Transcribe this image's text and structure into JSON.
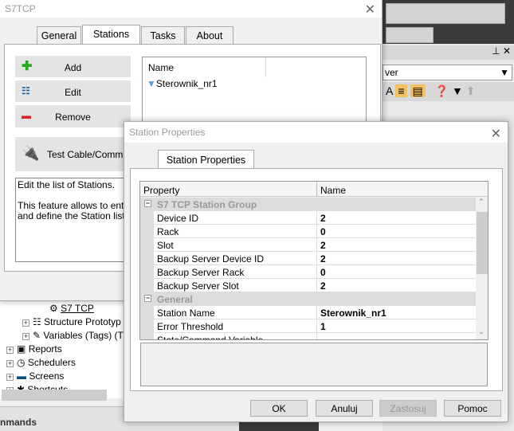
{
  "main_dialog": {
    "title": "S7TCP",
    "tabs": [
      "General",
      "Stations",
      "Tasks",
      "About"
    ],
    "active_tab": "Stations",
    "commands": {
      "add": "Add",
      "edit": "Edit",
      "remove": "Remove",
      "test": "Test Cable/Comm."
    },
    "description": [
      "Edit the list of Stations.",
      "This feature allows to enter and define the Station list"
    ],
    "list": {
      "header": "Name",
      "items": [
        "Sterownik_nr1"
      ]
    }
  },
  "background": {
    "dropdown_value": "ver",
    "tree": {
      "selected": "S7 TCP",
      "items": [
        "Structure Prototyp",
        "Variables (Tags) (T",
        "Reports",
        "Schedulers",
        "Screens",
        "Shortcuts"
      ]
    },
    "bottom_label": "nmands"
  },
  "props_dialog": {
    "title": "Station Properties",
    "tab": "Station Properties",
    "columns": [
      "Property",
      "Name"
    ],
    "groups": [
      {
        "name": "S7 TCP Station Group",
        "rows": [
          [
            "Device ID",
            "2"
          ],
          [
            "Rack",
            "0"
          ],
          [
            "Slot",
            "2"
          ],
          [
            "Backup Server Device ID",
            "2"
          ],
          [
            "Backup Server Rack",
            "0"
          ],
          [
            "Backup Server Slot",
            "2"
          ]
        ]
      },
      {
        "name": "General",
        "rows": [
          [
            "Station Name",
            "Sterownik_nr1"
          ],
          [
            "Error Threshold",
            "1"
          ],
          [
            "State/Command Variable",
            ""
          ]
        ]
      }
    ],
    "buttons": {
      "ok": "OK",
      "cancel": "Anuluj",
      "apply": "Zastosuj",
      "help": "Pomoc"
    },
    "apply_disabled": true
  }
}
